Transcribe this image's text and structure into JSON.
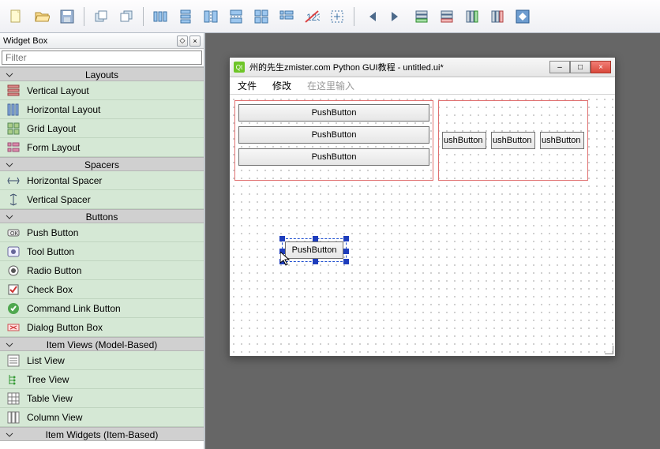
{
  "toolbar_icons": [
    "file-new-icon",
    "file-open-icon",
    "file-save-icon",
    "|",
    "raise-icon",
    "lower-icon",
    "|",
    "layout-horizontal-icon",
    "layout-vertical-icon",
    "layout-horiz-splitter-icon",
    "layout-vert-splitter-icon",
    "layout-grid-icon",
    "layout-form-icon",
    "break-layout-icon",
    "adjust-size-icon",
    "|",
    "jump-first-icon",
    "jump-last-icon",
    "add-row-icon",
    "remove-row-icon",
    "add-col-icon",
    "remove-col-icon",
    "fit-icon"
  ],
  "widgetbox": {
    "title": "Widget Box",
    "filter_placeholder": "Filter",
    "categories": [
      {
        "name": "Layouts",
        "items": [
          {
            "label": "Vertical Layout",
            "icon": "vertical-layout-icon"
          },
          {
            "label": "Horizontal Layout",
            "icon": "horizontal-layout-icon"
          },
          {
            "label": "Grid Layout",
            "icon": "grid-layout-icon"
          },
          {
            "label": "Form Layout",
            "icon": "form-layout-icon"
          }
        ]
      },
      {
        "name": "Spacers",
        "items": [
          {
            "label": "Horizontal Spacer",
            "icon": "horizontal-spacer-icon"
          },
          {
            "label": "Vertical Spacer",
            "icon": "vertical-spacer-icon"
          }
        ]
      },
      {
        "name": "Buttons",
        "items": [
          {
            "label": "Push Button",
            "icon": "push-button-icon"
          },
          {
            "label": "Tool Button",
            "icon": "tool-button-icon"
          },
          {
            "label": "Radio Button",
            "icon": "radio-button-icon"
          },
          {
            "label": "Check Box",
            "icon": "check-box-icon"
          },
          {
            "label": "Command Link Button",
            "icon": "command-link-icon"
          },
          {
            "label": "Dialog Button Box",
            "icon": "dialog-button-box-icon"
          }
        ]
      },
      {
        "name": "Item Views (Model-Based)",
        "items": [
          {
            "label": "List View",
            "icon": "list-view-icon"
          },
          {
            "label": "Tree View",
            "icon": "tree-view-icon"
          },
          {
            "label": "Table View",
            "icon": "table-view-icon"
          },
          {
            "label": "Column View",
            "icon": "column-view-icon"
          }
        ]
      },
      {
        "name": "Item Widgets (Item-Based)",
        "items": []
      }
    ]
  },
  "dock_btns": {
    "pin": "◇",
    "close": "×"
  },
  "form": {
    "title": "州的先生zmister.com Python GUI教程 - untitled.ui*",
    "menu": {
      "items": [
        "文件",
        "修改"
      ],
      "hint": "在这里输入"
    },
    "win_btns": {
      "min": "–",
      "max": "□",
      "close": "×"
    },
    "vbox": {
      "buttons": [
        "PushButton",
        "PushButton",
        "PushButton"
      ]
    },
    "hbox": {
      "buttons": [
        "ushButton",
        "ushButton",
        "ushButton"
      ]
    },
    "selected_button": "PushButton"
  }
}
